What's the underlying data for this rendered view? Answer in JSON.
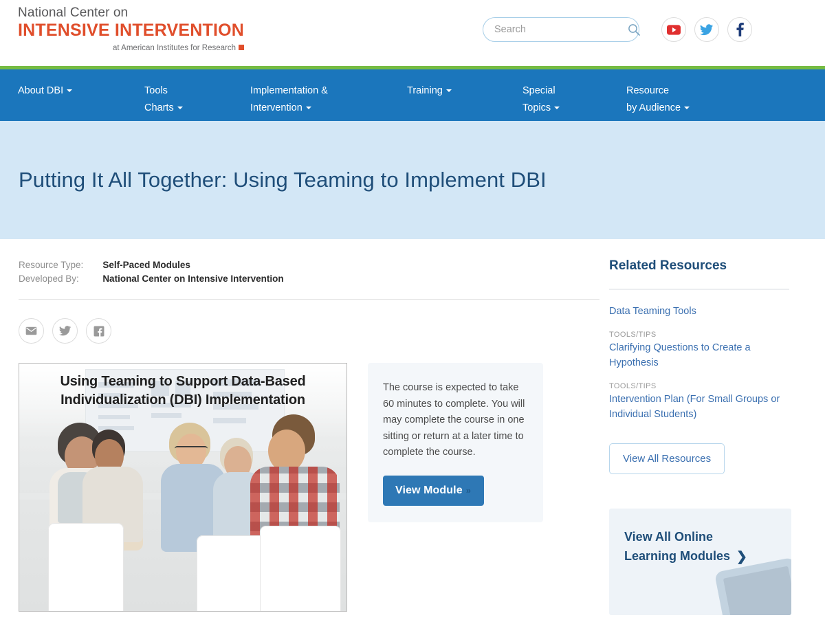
{
  "header": {
    "logo_line1": "National Center on",
    "logo_line2": "INTENSIVE INTERVENTION",
    "logo_line3": "at American Institutes for Research",
    "search_placeholder": "Search",
    "search_value": "",
    "social": [
      {
        "name": "youtube",
        "label": "YouTube",
        "color": "#e02f2f"
      },
      {
        "name": "twitter",
        "label": "Twitter",
        "color": "#3aa3e3"
      },
      {
        "name": "facebook",
        "label": "Facebook",
        "color": "#1f3d7a"
      }
    ]
  },
  "nav": {
    "accent_color": "#76bc43",
    "background_color": "#1b76bc",
    "items": [
      {
        "line1": "About DBI",
        "line2": "",
        "caret_on": 1
      },
      {
        "line1": "Tools",
        "line2": "Charts",
        "caret_on": 2
      },
      {
        "line1": "Implementation &",
        "line2": "Intervention",
        "caret_on": 2
      },
      {
        "line1": "Training",
        "line2": "",
        "caret_on": 1
      },
      {
        "line1": "Special",
        "line2": "Topics",
        "caret_on": 2
      },
      {
        "line1": "Resource",
        "line2": "by Audience",
        "caret_on": 2
      }
    ]
  },
  "hero": {
    "title": "Putting It All Together: Using Teaming to Implement DBI",
    "background_color": "#d3e7f6",
    "text_color": "#1f4e79"
  },
  "meta": {
    "rows": [
      {
        "label": "Resource Type:",
        "value": "Self-Paced Modules"
      },
      {
        "label": "Developed By:",
        "value": "National Center on Intensive Intervention"
      }
    ]
  },
  "share": [
    {
      "name": "email",
      "label": "Share by Email"
    },
    {
      "name": "twitter",
      "label": "Share on Twitter"
    },
    {
      "name": "facebook",
      "label": "Share on Facebook"
    }
  ],
  "module": {
    "thumb_title_line1": "Using Teaming to Support Data-Based",
    "thumb_title_line2": "Individualization (DBI) Implementation",
    "course_text": "The course is expected to take 60 minutes to complete. You will may complete the course in one sitting or return at a later time to complete the course.",
    "button_label": "View Module",
    "button_chevron": "»",
    "button_color": "#2e78b5"
  },
  "sidebar": {
    "title": "Related Resources",
    "resources": [
      {
        "category": "",
        "title": "Data Teaming Tools"
      },
      {
        "category": "TOOLS/TIPS",
        "title": "Clarifying Questions to Create a Hypothesis"
      },
      {
        "category": "TOOLS/TIPS",
        "title": "Intervention Plan (For Small Groups or Individual Students)"
      }
    ],
    "view_all_label": "View All Resources",
    "promo": {
      "line1": "View All Online",
      "line2": "Learning Modules",
      "chevron": "❯"
    }
  }
}
